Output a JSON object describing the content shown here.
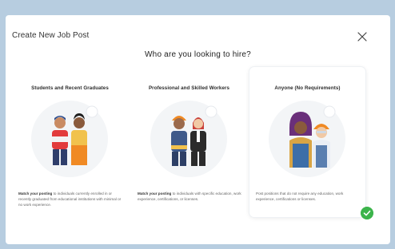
{
  "dialog": {
    "title": "Create New Job Post",
    "heading": "Who are you looking to hire?",
    "close_icon": "close-icon"
  },
  "cards": [
    {
      "title": "Students and Recent Graduates",
      "desc_lead": "Match your posting",
      "desc_rest": " to individuals currently enrolled in or recently graduated from educational institutions with minimal or no work experience.",
      "selected": false
    },
    {
      "title": "Professional and Skilled Workers",
      "desc_lead": "Match your posting",
      "desc_rest": " to individuals with specific education, work experience, certifications, or licenses.",
      "selected": false
    },
    {
      "title": "Anyone (No Requirements)",
      "desc_lead": "",
      "desc_rest": "Post positions that do not require any education, work experience, certifications or licenses.",
      "selected": true
    }
  ],
  "colors": {
    "frame": "#b7cde0",
    "check": "#3cb44b"
  }
}
